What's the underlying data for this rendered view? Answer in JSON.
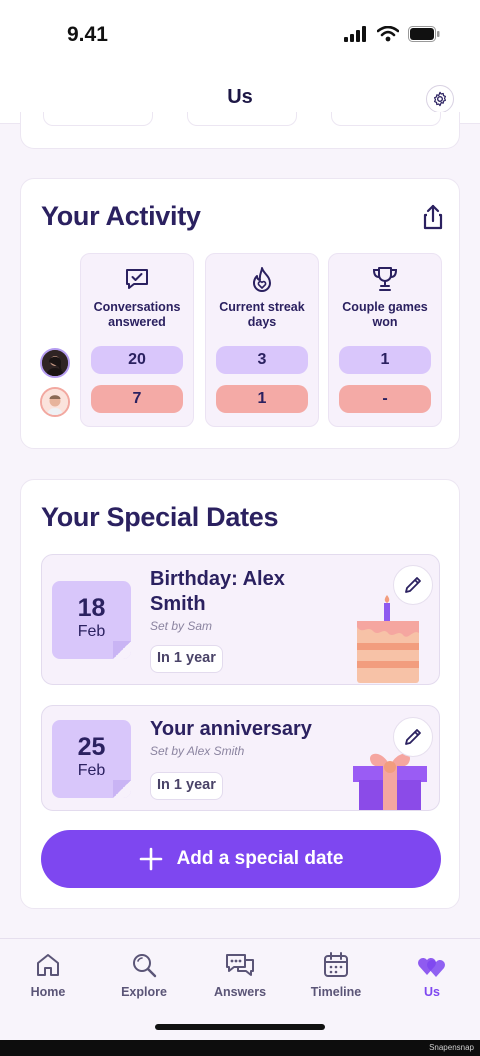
{
  "status": {
    "time": "9.41"
  },
  "header": {
    "title": "Us"
  },
  "activity": {
    "title": "Your Activity",
    "stats": [
      {
        "label": "Conversations answered",
        "icon": "chat-check-icon",
        "user1": "20",
        "user2": "7"
      },
      {
        "label": "Current streak days",
        "icon": "flame-heart-icon",
        "user1": "3",
        "user2": "1"
      },
      {
        "label": "Couple games won",
        "icon": "trophy-icon",
        "user1": "1",
        "user2": "-"
      }
    ]
  },
  "special_dates": {
    "title": "Your Special Dates",
    "items": [
      {
        "day": "18",
        "month": "Feb",
        "title": "Birthday: Alex Smith",
        "set_by": "Set by Sam",
        "countdown": "In 1 year",
        "icon": "birthday-cake-icon"
      },
      {
        "day": "25",
        "month": "Feb",
        "title": "Your anniversary",
        "set_by": "Set by Alex Smith",
        "countdown": "In 1 year",
        "icon": "gift-box-icon"
      }
    ],
    "add_label": "Add a special date"
  },
  "tabs": [
    {
      "label": "Home",
      "icon": "home-icon",
      "active": false
    },
    {
      "label": "Explore",
      "icon": "search-icon",
      "active": false
    },
    {
      "label": "Answers",
      "icon": "chat-bubbles-icon",
      "active": false
    },
    {
      "label": "Timeline",
      "icon": "calendar-icon",
      "active": false
    },
    {
      "label": "Us",
      "icon": "hearts-icon",
      "active": true
    }
  ],
  "watermark": "Snapensnap",
  "colors": {
    "accent": "#7e47f0",
    "user1": "#d9c6fb",
    "user2": "#f4aaa6",
    "text": "#2b2160"
  }
}
